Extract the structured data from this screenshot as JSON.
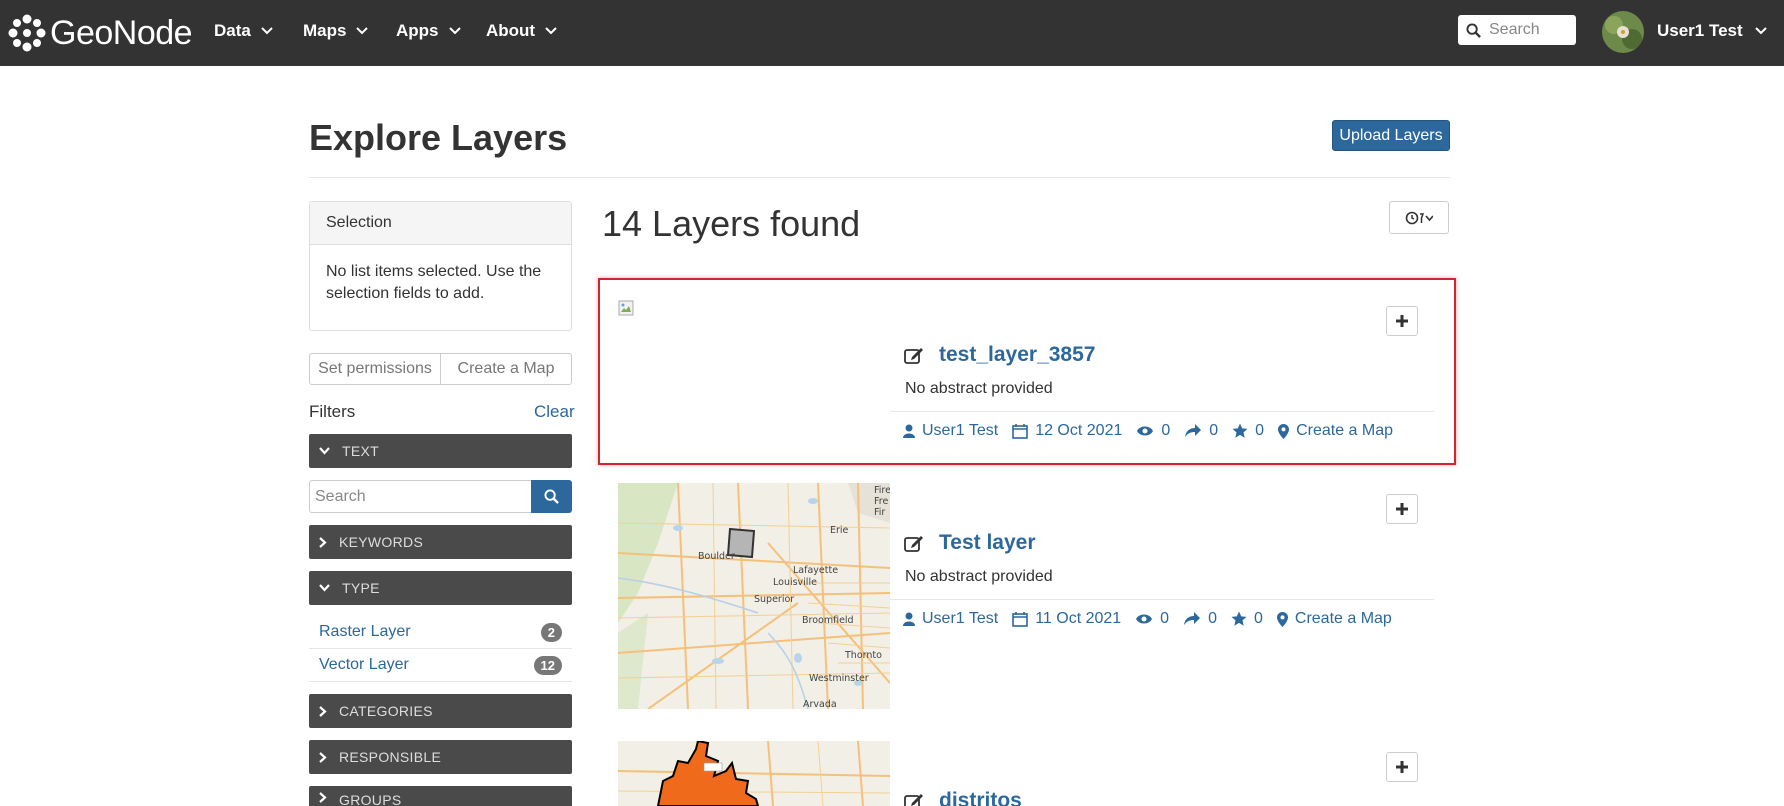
{
  "navbar": {
    "brand": "GeoNode",
    "menu": [
      {
        "label": "Data"
      },
      {
        "label": "Maps"
      },
      {
        "label": "Apps"
      },
      {
        "label": "About"
      }
    ],
    "search_placeholder": "Search",
    "user_name": "User1 Test"
  },
  "header": {
    "title": "Explore Layers",
    "upload_label": "Upload Layers"
  },
  "sidebar": {
    "selection_title": "Selection",
    "selection_text": "No list items selected. Use the selection fields to add.",
    "set_permissions_label": "Set permissions",
    "create_map_label": "Create a Map",
    "filters_label": "Filters",
    "clear_label": "Clear",
    "text_facet": "TEXT",
    "text_search_placeholder": "Search",
    "keywords_facet": "KEYWORDS",
    "type_facet": "TYPE",
    "type_items": [
      {
        "label": "Raster Layer",
        "count": "2"
      },
      {
        "label": "Vector Layer",
        "count": "12"
      }
    ],
    "categories_facet": "CATEGORIES",
    "responsible_facet": "RESPONSIBLE",
    "groups_facet": "GROUPS"
  },
  "results": {
    "count_text": "14 Layers found",
    "layers": [
      {
        "title": "test_layer_3857",
        "abstract": "No abstract provided",
        "owner": "User1 Test",
        "date": "12 Oct 2021",
        "views": "0",
        "shares": "0",
        "rating": "0",
        "action": "Create a Map"
      },
      {
        "title": "Test layer",
        "abstract": "No abstract provided",
        "owner": "User1 Test",
        "date": "11 Oct 2021",
        "views": "0",
        "shares": "0",
        "rating": "0",
        "action": "Create a Map"
      },
      {
        "title": "distritos"
      }
    ],
    "map_labels": [
      "Boulder",
      "Erie",
      "Lafayette",
      "Louisville",
      "Superior",
      "Broomfield",
      "Thornto",
      "Westminster",
      "Arvada",
      "Fire",
      "Fre",
      "Fir"
    ]
  },
  "colors": {
    "navbar_bg": "#333333",
    "link": "#2c689c",
    "facet_bg": "#4a4a4a",
    "highlight": "#d0262d"
  }
}
